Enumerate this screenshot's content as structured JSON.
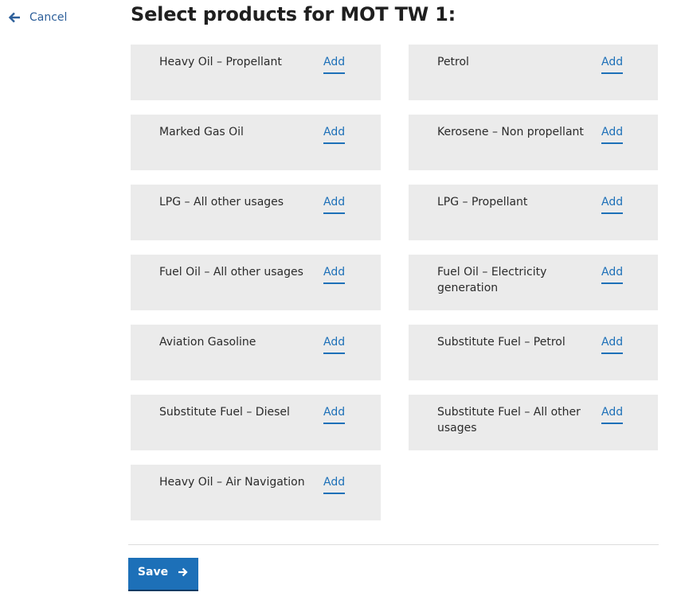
{
  "nav": {
    "cancel_label": "Cancel"
  },
  "page": {
    "title": "Select products for MOT TW 1:"
  },
  "products": [
    {
      "name": "Heavy Oil – Propellant",
      "action": "Add"
    },
    {
      "name": "Petrol",
      "action": "Add"
    },
    {
      "name": "Marked Gas Oil",
      "action": "Add"
    },
    {
      "name": "Kerosene – Non propellant",
      "action": "Add"
    },
    {
      "name": "LPG – All other usages",
      "action": "Add"
    },
    {
      "name": "LPG – Propellant",
      "action": "Add"
    },
    {
      "name": "Fuel Oil – All other usages",
      "action": "Add"
    },
    {
      "name": "Fuel Oil – Electricity generation",
      "action": "Add"
    },
    {
      "name": "Aviation Gasoline",
      "action": "Add"
    },
    {
      "name": "Substitute Fuel – Petrol",
      "action": "Add"
    },
    {
      "name": "Substitute Fuel – Diesel",
      "action": "Add"
    },
    {
      "name": "Substitute Fuel – All other usages",
      "action": "Add"
    },
    {
      "name": "Heavy Oil – Air Navigation",
      "action": "Add"
    }
  ],
  "actions": {
    "save_label": "Save"
  },
  "icons": {
    "cancel": "arrow-left-icon",
    "save": "arrow-right-icon"
  },
  "colors": {
    "link": "#1d70b8",
    "card_background": "#ebebeb",
    "button_background": "#1d70b8"
  }
}
